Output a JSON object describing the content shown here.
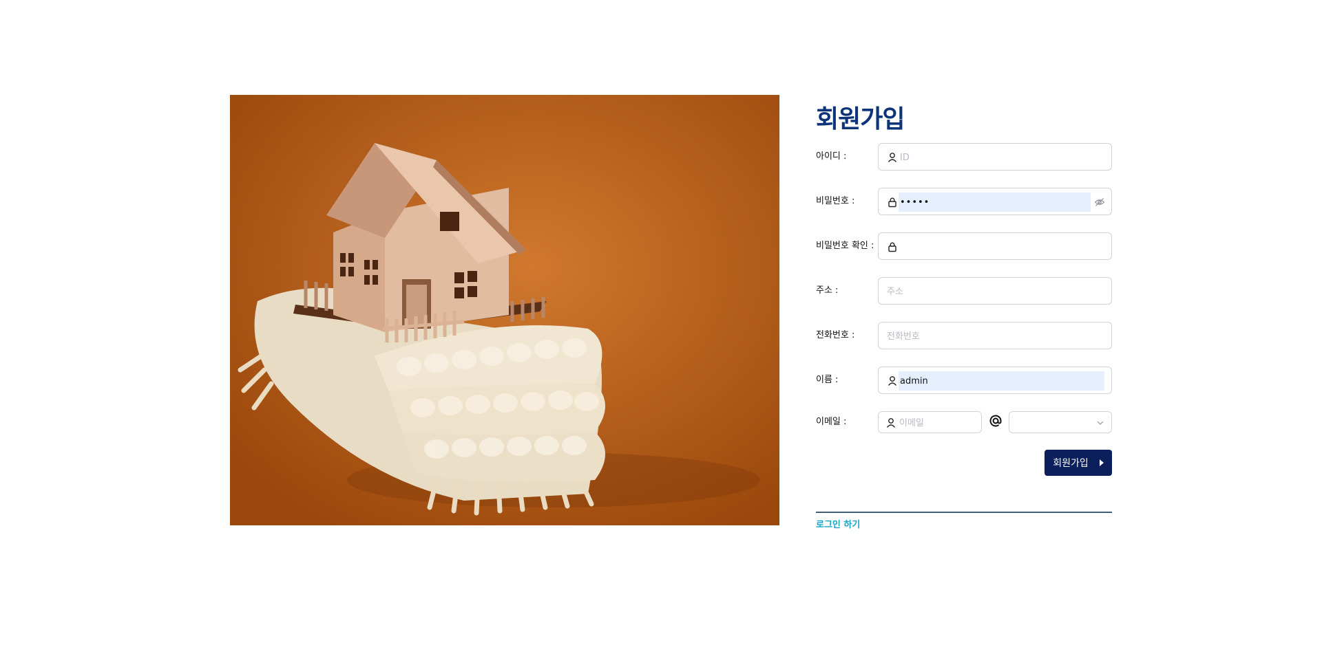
{
  "page": {
    "title": "회원가입",
    "hero_image": "wooden-house-on-knitted-scarf"
  },
  "form": {
    "fields": [
      {
        "label": "아이디 :",
        "placeholder": "ID",
        "value": "",
        "icon": "user-icon"
      },
      {
        "label": "비밀번호 :",
        "placeholder": "",
        "value": "•••••",
        "icon": "lock-icon",
        "toggle_icon": "eye-slash-icon"
      },
      {
        "label": "비밀번호 확인 :",
        "placeholder": "",
        "value": "",
        "icon": "lock-icon"
      },
      {
        "label": "주소 :",
        "placeholder": "주소",
        "value": ""
      },
      {
        "label": "전화번호 :",
        "placeholder": "전화번호",
        "value": ""
      },
      {
        "label": "이름 :",
        "placeholder": "",
        "value": "admin",
        "icon": "user-icon"
      }
    ],
    "email": {
      "label": "이메일 :",
      "local_placeholder": "이메일",
      "at_icon": "at-sign-icon",
      "domain_value": ""
    },
    "submit_label": "회원가입",
    "login_link": "로그인 하기"
  },
  "colors": {
    "title": "#0d3378",
    "button": "#0a1f5c",
    "link": "#15a6c7",
    "autofill": "#e6effd"
  }
}
